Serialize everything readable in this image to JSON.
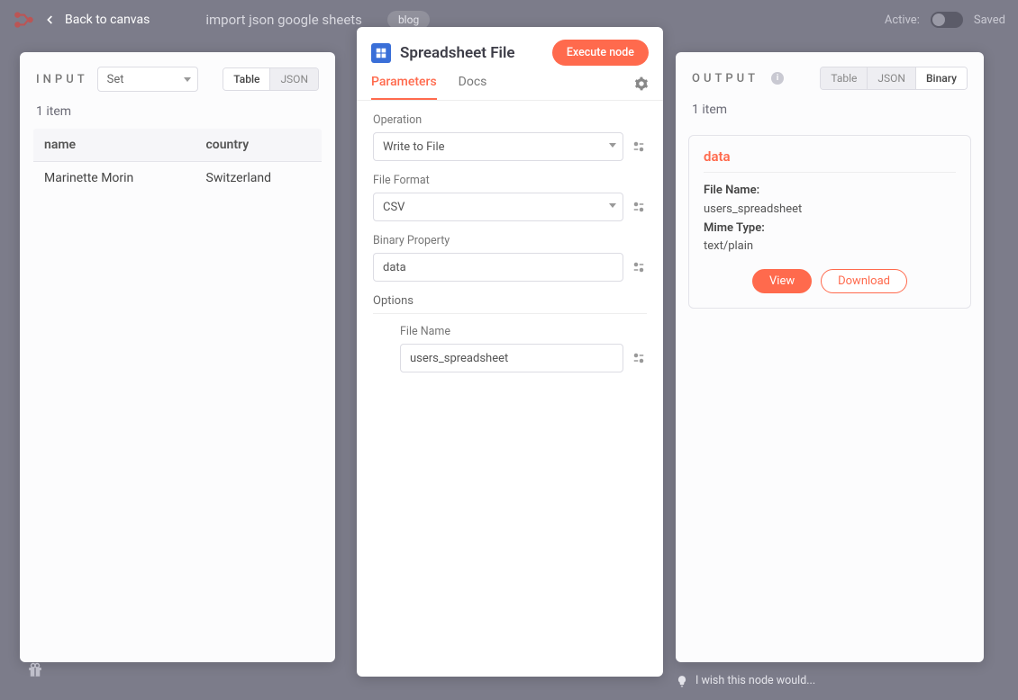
{
  "header": {
    "back_label": "Back to canvas",
    "workflow_name": "import json google sheets",
    "tag": "blog",
    "active_label": "Active:",
    "saved_label": "Saved"
  },
  "input": {
    "title": "INPUT",
    "source": "Set",
    "views": {
      "table": "Table",
      "json": "JSON"
    },
    "item_count": "1 item",
    "columns": [
      "name",
      "country"
    ],
    "rows": [
      {
        "name": "Marinette Morin",
        "country": "Switzerland"
      }
    ]
  },
  "node": {
    "title": "Spreadsheet File",
    "execute_label": "Execute node",
    "tabs": {
      "parameters": "Parameters",
      "docs": "Docs"
    },
    "fields": {
      "operation": {
        "label": "Operation",
        "value": "Write to File"
      },
      "file_format": {
        "label": "File Format",
        "value": "CSV"
      },
      "binary_property": {
        "label": "Binary Property",
        "value": "data"
      },
      "options_label": "Options",
      "file_name": {
        "label": "File Name",
        "value": "users_spreadsheet"
      }
    }
  },
  "output": {
    "title": "OUTPUT",
    "views": {
      "table": "Table",
      "json": "JSON",
      "binary": "Binary"
    },
    "item_count": "1 item",
    "binary": {
      "title": "data",
      "file_name_label": "File Name:",
      "file_name": "users_spreadsheet",
      "mime_label": "Mime Type:",
      "mime": "text/plain",
      "view_label": "View",
      "download_label": "Download"
    }
  },
  "footer": {
    "feedback": "I wish this node would..."
  }
}
